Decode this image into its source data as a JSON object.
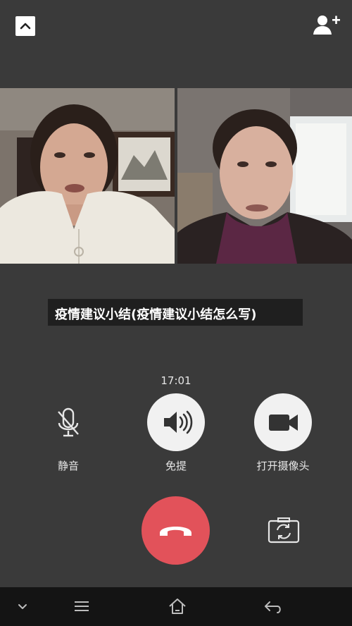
{
  "header": {
    "collapse_icon": "chevron-up-icon",
    "add_participant_icon": "add-user-icon"
  },
  "video": {
    "participants": [
      {
        "position": "left"
      },
      {
        "position": "right"
      }
    ]
  },
  "caption": {
    "text": "疫情建议小结(疫情建议小结怎么写)"
  },
  "call": {
    "timer": "17:01"
  },
  "controls": {
    "mute_label": "静音",
    "speaker_label": "免提",
    "camera_label": "打开摄像头",
    "hangup_icon": "phone-hangup-icon",
    "switch_camera_icon": "switch-camera-icon",
    "hangup_color": "#e2525a"
  },
  "navbar": {
    "icons": [
      "chevron-down-icon",
      "menu-icon",
      "home-icon",
      "back-icon"
    ]
  }
}
